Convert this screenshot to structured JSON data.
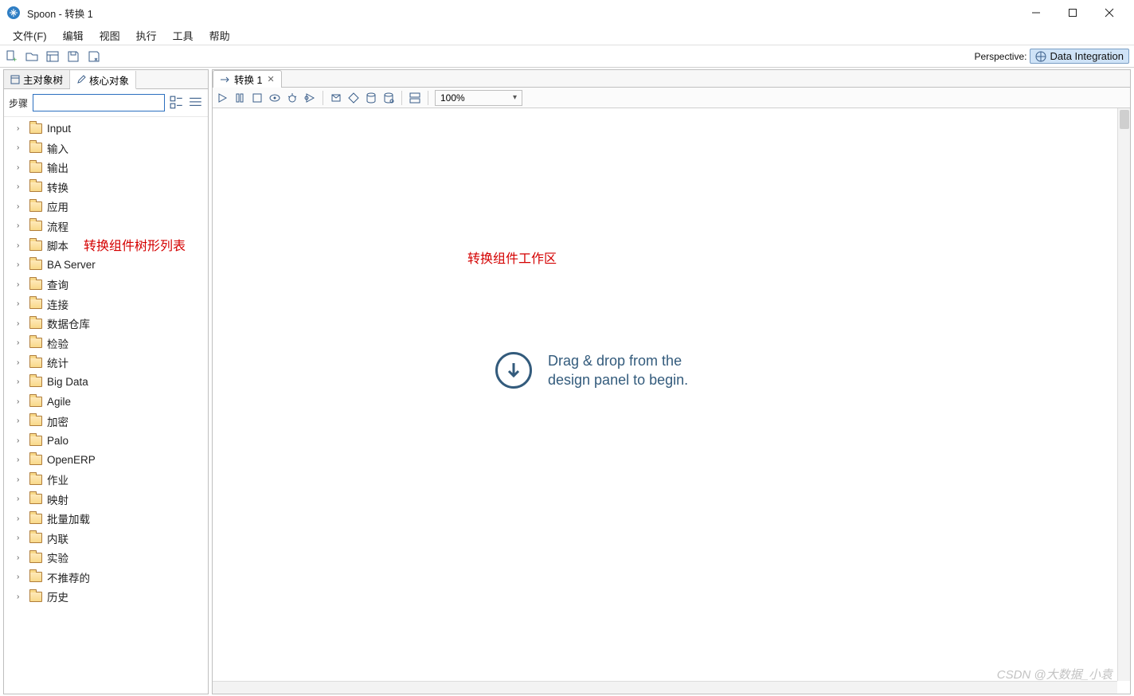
{
  "window": {
    "title": "Spoon - 转换 1"
  },
  "menu": {
    "file": "文件(F)",
    "edit": "编辑",
    "view": "视图",
    "run": "执行",
    "tools": "工具",
    "help": "帮助"
  },
  "toolbar": {
    "perspective_label": "Perspective:",
    "perspective_name": "Data Integration"
  },
  "sidebar": {
    "tab_main": "主对象树",
    "tab_core": "核心对象",
    "search_label": "步骤",
    "search_value": "",
    "items": [
      "Input",
      "输入",
      "输出",
      "转换",
      "应用",
      "流程",
      "脚本",
      "BA Server",
      "查询",
      "连接",
      "数据仓库",
      "检验",
      "统计",
      "Big Data",
      "Agile",
      "加密",
      "Palo",
      "OpenERP",
      "作业",
      "映射",
      "批量加载",
      "内联",
      "实验",
      "不推荐的",
      "历史"
    ],
    "overlay": "转换组件树形列表"
  },
  "editor": {
    "tab_label": "转换 1",
    "zoom": "100%",
    "overlay": "转换组件工作区",
    "hint_line1": "Drag & drop from the",
    "hint_line2": "design panel to begin."
  },
  "watermark": "CSDN @大数据_小袁"
}
